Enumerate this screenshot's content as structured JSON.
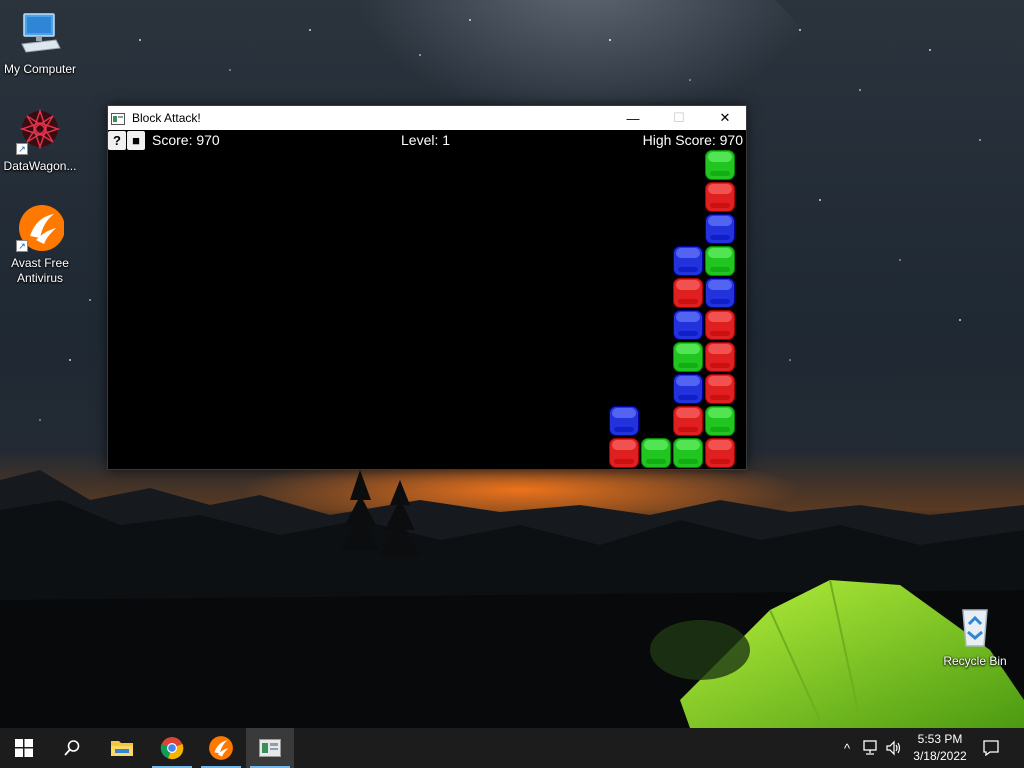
{
  "desktop": {
    "icons": [
      {
        "label": "My Computer"
      },
      {
        "label": "DataWagon..."
      },
      {
        "label": "Avast Free Antivirus"
      },
      {
        "label": "Recycle Bin"
      }
    ]
  },
  "window": {
    "title": "Block Attack!",
    "controls": {
      "minimize": "—",
      "maximize": "☐",
      "close": "✕"
    },
    "hud": {
      "help_button": "?",
      "stop_button": "■",
      "score": "Score: 970",
      "level": "Level: 1",
      "high_score": "High Score: 970"
    },
    "board": {
      "colors": {
        "red": "#e02020",
        "green": "#22c422",
        "blue": "#2233dd"
      },
      "blocks": [
        {
          "col": 19,
          "row": 0,
          "color": "green"
        },
        {
          "col": 19,
          "row": 1,
          "color": "red"
        },
        {
          "col": 19,
          "row": 2,
          "color": "blue"
        },
        {
          "col": 18,
          "row": 3,
          "color": "blue"
        },
        {
          "col": 19,
          "row": 3,
          "color": "green"
        },
        {
          "col": 18,
          "row": 4,
          "color": "red"
        },
        {
          "col": 19,
          "row": 4,
          "color": "blue"
        },
        {
          "col": 18,
          "row": 5,
          "color": "blue"
        },
        {
          "col": 19,
          "row": 5,
          "color": "red"
        },
        {
          "col": 18,
          "row": 6,
          "color": "green"
        },
        {
          "col": 19,
          "row": 6,
          "color": "red"
        },
        {
          "col": 18,
          "row": 7,
          "color": "blue"
        },
        {
          "col": 19,
          "row": 7,
          "color": "red"
        },
        {
          "col": 16,
          "row": 8,
          "color": "blue"
        },
        {
          "col": 18,
          "row": 8,
          "color": "red"
        },
        {
          "col": 19,
          "row": 8,
          "color": "green"
        },
        {
          "col": 16,
          "row": 9,
          "color": "red"
        },
        {
          "col": 17,
          "row": 9,
          "color": "green"
        },
        {
          "col": 18,
          "row": 9,
          "color": "green"
        },
        {
          "col": 19,
          "row": 9,
          "color": "red"
        }
      ]
    }
  },
  "taskbar": {
    "items": [
      {
        "name": "start-button",
        "icon": "windows-logo-icon"
      },
      {
        "name": "search-button",
        "icon": "search-icon"
      },
      {
        "name": "file-explorer",
        "icon": "folder-icon"
      },
      {
        "name": "chrome",
        "icon": "chrome-icon"
      },
      {
        "name": "avast",
        "icon": "avast-icon"
      },
      {
        "name": "block-attack",
        "icon": "block-attack-app-icon"
      }
    ],
    "tray": {
      "chevron": "^",
      "time": "5:53 PM",
      "date": "3/18/2022"
    }
  }
}
